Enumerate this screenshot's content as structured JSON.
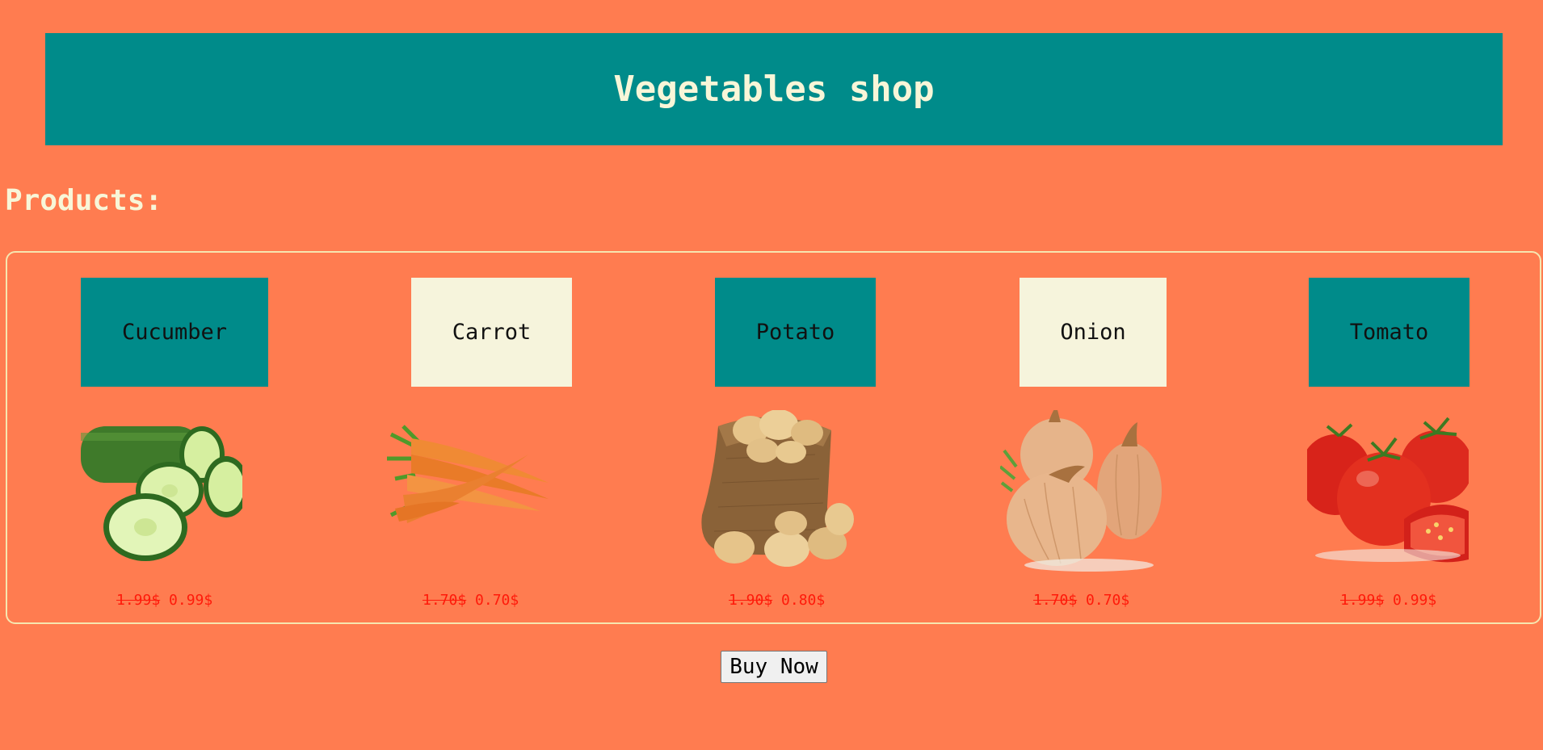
{
  "header": {
    "title": "Vegetables shop"
  },
  "products_heading": "Products:",
  "products": [
    {
      "name": "Cucumber",
      "old_price": "1.99$",
      "new_price": "0.99$"
    },
    {
      "name": "Carrot",
      "old_price": "1.70$",
      "new_price": "0.70$"
    },
    {
      "name": "Potato",
      "old_price": "1.90$",
      "new_price": "0.80$"
    },
    {
      "name": "Onion",
      "old_price": "1.70$",
      "new_price": "0.70$"
    },
    {
      "name": "Tomato",
      "old_price": "1.99$",
      "new_price": "0.99$"
    }
  ],
  "buy_button": "Buy Now",
  "colors": {
    "background": "#ff7c50",
    "header_bg": "#008b8a",
    "header_text": "#f8f6d8",
    "cream": "#f6f4dc",
    "price_red": "#ff1a0a"
  }
}
